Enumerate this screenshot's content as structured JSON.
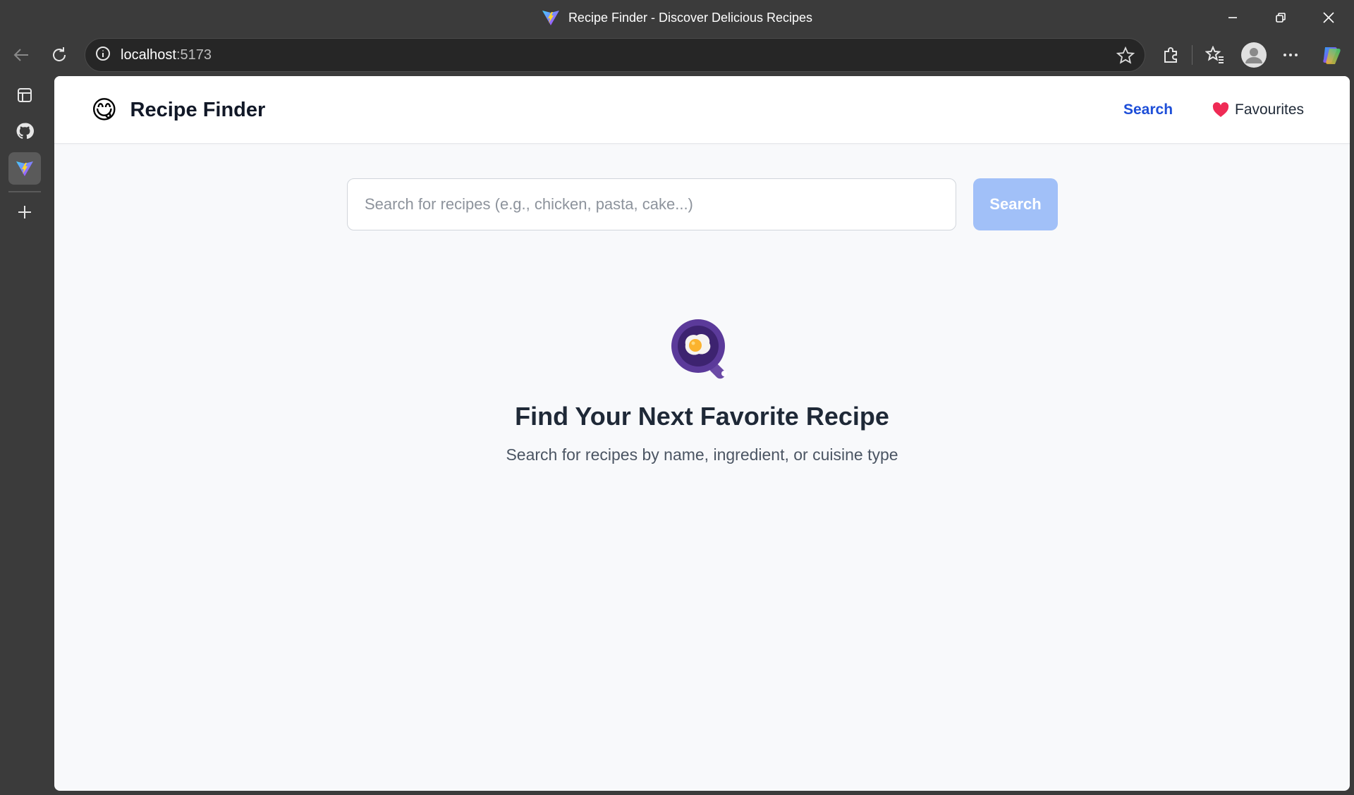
{
  "browser": {
    "window_title": "Recipe Finder - Discover Delicious Recipes",
    "url_host": "localhost",
    "url_port": ":5173"
  },
  "icons": {
    "back": "back-arrow-icon",
    "reload": "reload-icon",
    "info": "info-icon",
    "favorite": "star-icon",
    "extensions": "puzzle-icon",
    "favorites_bar": "favorites-icon",
    "profile": "profile-avatar-icon",
    "more": "more-icon",
    "copilot": "copilot-icon",
    "sidebar": [
      "tab-view-icon",
      "github-icon",
      "vite-icon",
      "plus-icon"
    ]
  },
  "app": {
    "brand_emoji": "😋",
    "brand_name": "Recipe Finder",
    "nav": {
      "search": "Search",
      "favourites_icon": "❤️",
      "favourites": "Favourites"
    },
    "search": {
      "placeholder": "Search for recipes (e.g., chicken, pasta, cake...)",
      "value": "",
      "button": "Search"
    },
    "empty_state": {
      "icon": "frying-pan-egg-icon",
      "title": "Find Your Next Favorite Recipe",
      "subtitle": "Search for recipes by name, ingredient, or cuisine type"
    }
  },
  "colors": {
    "accent_link": "#1d4ed8",
    "search_button": "#a1c0f8",
    "page_bg": "#f8f9fb"
  }
}
